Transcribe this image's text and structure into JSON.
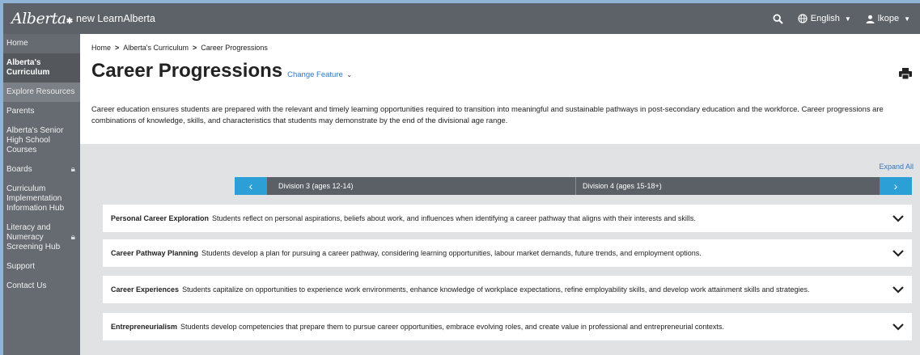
{
  "topbar": {
    "logo_text": "Alberta",
    "site_name": "new LearnAlberta",
    "language": "English",
    "user": "lkope"
  },
  "sidebar": {
    "items": [
      {
        "label": "Home"
      },
      {
        "label": "Alberta's Curriculum"
      },
      {
        "label": "Explore Resources"
      },
      {
        "label": "Parents"
      },
      {
        "label": "Alberta's Senior High School Courses"
      },
      {
        "label": "Boards"
      },
      {
        "label": "Curriculum Implementation Information Hub"
      },
      {
        "label": "Literacy and Numeracy Screening Hub"
      },
      {
        "label": "Support"
      },
      {
        "label": "Contact Us"
      }
    ]
  },
  "breadcrumb": {
    "items": [
      "Home",
      "Alberta's Curriculum",
      "Career Progressions"
    ]
  },
  "page": {
    "title": "Career Progressions",
    "change_feature": "Change Feature",
    "intro": "Career education ensures students are prepared with the relevant and timely learning opportunities required to transition into meaningful and sustainable pathways in post-secondary education and the workforce. Career progressions are combinations of knowledge, skills, and characteristics that students may demonstrate by the end of the divisional age range."
  },
  "content": {
    "expand_all": "Expand All",
    "divisions": [
      "Division 3 (ages 12-14)",
      "Division 4 (ages 15-18+)"
    ],
    "accordions": [
      {
        "title": "Personal Career Exploration",
        "text": "Students reflect on personal aspirations, beliefs about work, and influences when identifying a career pathway that aligns with their interests and skills."
      },
      {
        "title": "Career Pathway Planning",
        "text": "Students develop a plan for pursuing a career pathway, considering learning opportunities, labour market demands, future trends, and employment options."
      },
      {
        "title": "Career Experiences",
        "text": "Students capitalize on opportunities to experience work environments, enhance knowledge of workplace expectations, refine employability skills, and develop work attainment skills and strategies."
      },
      {
        "title": "Entrepreneurialism",
        "text": "Students develop competencies that prepare them to pursue career opportunities, embrace evolving roles, and create value in professional and entrepreneurial contexts."
      }
    ]
  }
}
